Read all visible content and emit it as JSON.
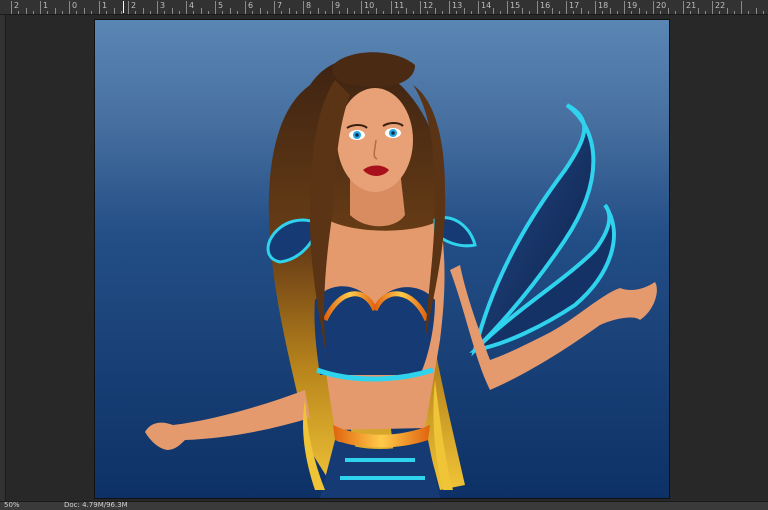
{
  "ruler": {
    "top_labels": [
      "2",
      "1",
      "0",
      "1",
      "2",
      "3",
      "4",
      "5",
      "6",
      "7",
      "8",
      "9",
      "10",
      "11",
      "12",
      "13",
      "14",
      "15",
      "16",
      "17",
      "18",
      "19",
      "20",
      "21",
      "22"
    ]
  },
  "canvas": {
    "background_top": "#5b87b3",
    "background_bottom": "#0d3166"
  },
  "status_bar": {
    "zoom": "50%",
    "doc_info": "Doc: 4.79M/96.3M"
  }
}
